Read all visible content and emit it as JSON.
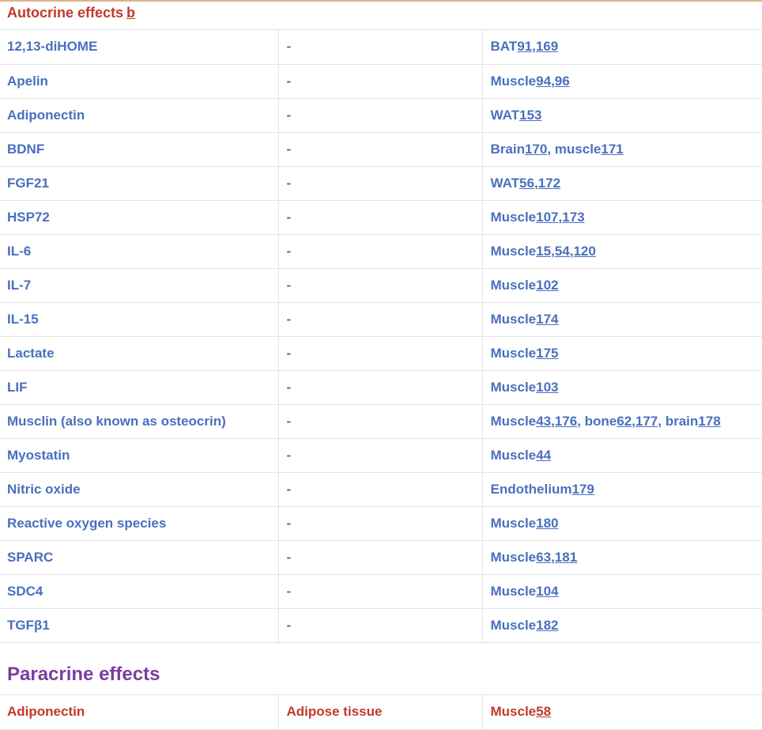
{
  "autocrine": {
    "title": "Autocrine effects",
    "note": "b",
    "rows": [
      {
        "name": "12,13-diHOME",
        "source": "-",
        "targets": [
          {
            "tissue": "BAT",
            "refs": [
              "91",
              "169"
            ]
          }
        ]
      },
      {
        "name": "Apelin",
        "source": "-",
        "targets": [
          {
            "tissue": "Muscle",
            "refs": [
              "94",
              "96"
            ]
          }
        ]
      },
      {
        "name": "Adiponectin",
        "source": "-",
        "targets": [
          {
            "tissue": "WAT",
            "refs": [
              "153"
            ]
          }
        ]
      },
      {
        "name": "BDNF",
        "source": "-",
        "targets": [
          {
            "tissue": "Brain",
            "refs": [
              "170"
            ]
          },
          {
            "tissue": "muscle",
            "refs": [
              "171"
            ]
          }
        ]
      },
      {
        "name": "FGF21",
        "source": "-",
        "targets": [
          {
            "tissue": "WAT",
            "refs": [
              "56",
              "172"
            ]
          }
        ]
      },
      {
        "name": "HSP72",
        "source": "-",
        "targets": [
          {
            "tissue": "Muscle",
            "refs": [
              "107",
              "173"
            ]
          }
        ]
      },
      {
        "name": "IL-6",
        "source": "-",
        "targets": [
          {
            "tissue": "Muscle",
            "refs": [
              "15",
              "54",
              "120"
            ]
          }
        ]
      },
      {
        "name": "IL-7",
        "source": "-",
        "targets": [
          {
            "tissue": "Muscle",
            "refs": [
              "102"
            ]
          }
        ]
      },
      {
        "name": "IL-15",
        "source": "-",
        "targets": [
          {
            "tissue": "Muscle",
            "refs": [
              "174"
            ]
          }
        ]
      },
      {
        "name": "Lactate",
        "source": "-",
        "targets": [
          {
            "tissue": "Muscle",
            "refs": [
              "175"
            ]
          }
        ]
      },
      {
        "name": "LIF",
        "source": "-",
        "targets": [
          {
            "tissue": "Muscle",
            "refs": [
              "103"
            ]
          }
        ]
      },
      {
        "name": "Musclin (also known as osteocrin)",
        "source": "-",
        "targets": [
          {
            "tissue": "Muscle",
            "refs": [
              "43",
              "176"
            ]
          },
          {
            "tissue": "bone",
            "refs": [
              "62",
              "177"
            ]
          },
          {
            "tissue": "brain",
            "refs": [
              "178"
            ]
          }
        ]
      },
      {
        "name": "Myostatin",
        "source": "-",
        "targets": [
          {
            "tissue": "Muscle",
            "refs": [
              "44"
            ]
          }
        ]
      },
      {
        "name": "Nitric oxide",
        "source": "-",
        "targets": [
          {
            "tissue": "Endothelium",
            "refs": [
              "179"
            ]
          }
        ]
      },
      {
        "name": "Reactive oxygen species",
        "source": "-",
        "targets": [
          {
            "tissue": "Muscle",
            "refs": [
              "180"
            ]
          }
        ]
      },
      {
        "name": "SPARC",
        "source": "-",
        "targets": [
          {
            "tissue": "Muscle",
            "refs": [
              "63",
              "181"
            ]
          }
        ]
      },
      {
        "name": "SDC4",
        "source": "-",
        "targets": [
          {
            "tissue": "Muscle",
            "refs": [
              "104"
            ]
          }
        ]
      },
      {
        "name": "TGFβ1",
        "source": "-",
        "targets": [
          {
            "tissue": "Muscle",
            "refs": [
              "182"
            ]
          }
        ]
      }
    ]
  },
  "paracrine": {
    "title": "Paracrine effects",
    "rows": [
      {
        "name": "Adiponectin",
        "source": "Adipose tissue",
        "targets": [
          {
            "tissue": "Muscle",
            "refs": [
              "58"
            ]
          }
        ]
      }
    ]
  },
  "colors": {
    "autocrine_text": "#4a6fbf",
    "paracrine_text": "#c0392b",
    "section_header_autocrine": "#c0392b",
    "section_header_paracrine": "#7a3ea1",
    "top_rule": "#d9b48a"
  }
}
